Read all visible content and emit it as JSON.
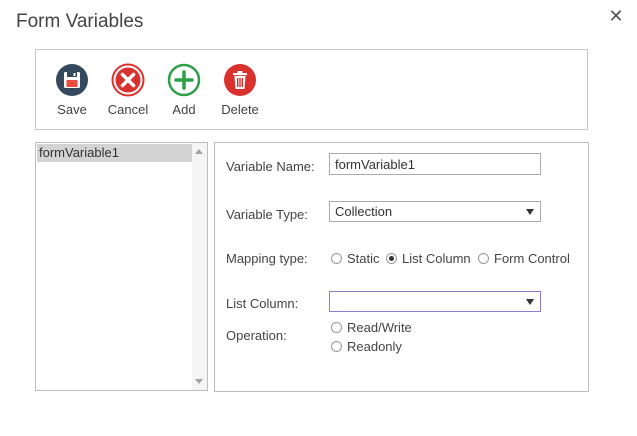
{
  "dialog": {
    "title": "Form Variables",
    "close_glyph": "✕"
  },
  "toolbar": {
    "save_label": "Save",
    "cancel_label": "Cancel",
    "add_label": "Add",
    "delete_label": "Delete",
    "icons": [
      "floppy-disk-icon",
      "cancel-x-icon",
      "add-plus-icon",
      "trash-icon"
    ],
    "colors": {
      "save": "#34495e",
      "cancel": "#d9322e",
      "add": "#2e9e48",
      "delete": "#d9322e"
    }
  },
  "variables_list": {
    "items": [
      "formVariable1"
    ],
    "selected_index": 0
  },
  "form": {
    "variable_name_label": "Variable Name:",
    "variable_name_value": "formVariable1",
    "variable_type_label": "Variable Type:",
    "variable_type_value": "Collection",
    "mapping_type_label": "Mapping type:",
    "mapping_options": [
      "Static",
      "List Column",
      "Form Control"
    ],
    "mapping_selected": "List Column",
    "list_column_label": "List Column:",
    "list_column_value": "",
    "operation_label": "Operation:",
    "operation_options": [
      "Read/Write",
      "Readonly"
    ],
    "operation_selected": null
  }
}
